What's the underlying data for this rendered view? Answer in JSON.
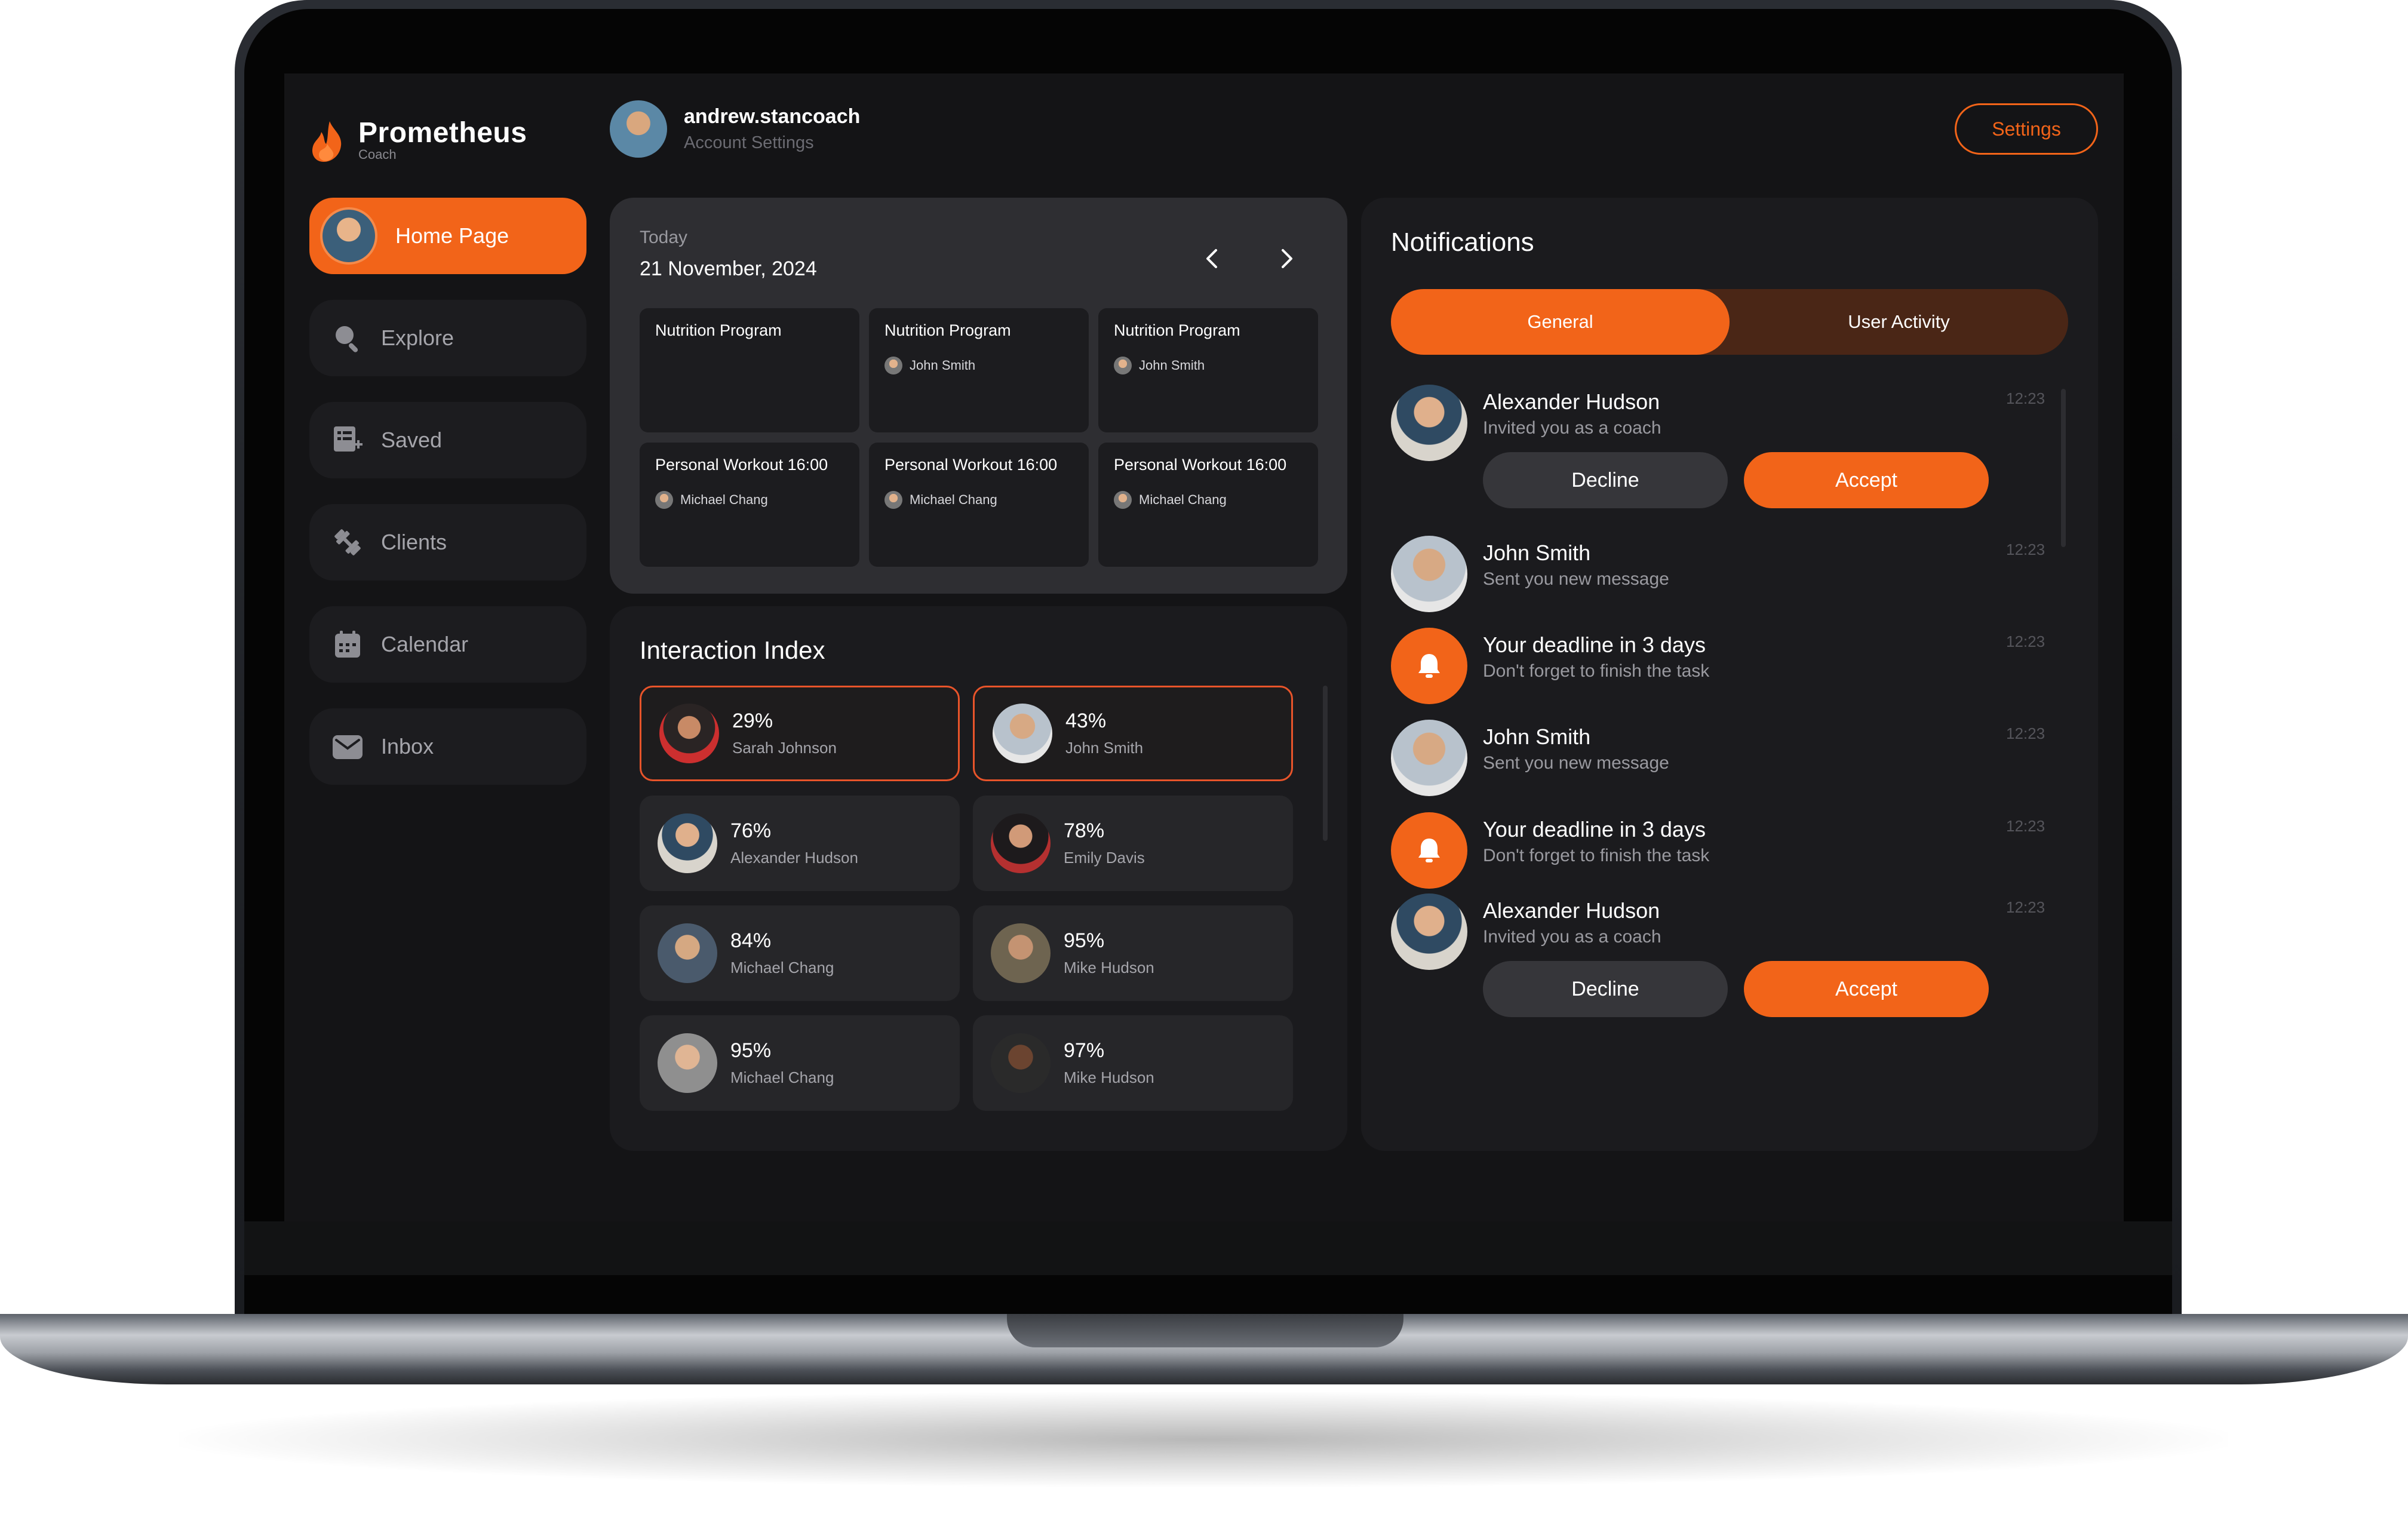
{
  "brand": {
    "name": "Prometheus",
    "sub": "Coach",
    "accent": "#f26419"
  },
  "user": {
    "name": "andrew.stancoach",
    "subtitle": "Account Settings"
  },
  "header": {
    "settings_label": "Settings"
  },
  "nav": {
    "items": [
      {
        "label": "Home Page",
        "icon": "avatar",
        "active": true
      },
      {
        "label": "Explore",
        "icon": "search-icon"
      },
      {
        "label": "Saved",
        "icon": "saved-list-icon"
      },
      {
        "label": "Clients",
        "icon": "dumbbell-icon"
      },
      {
        "label": "Calendar",
        "icon": "calendar-icon"
      },
      {
        "label": "Inbox",
        "icon": "mail-icon"
      }
    ]
  },
  "calendar": {
    "label": "Today",
    "date": "21 November, 2024",
    "cards": [
      {
        "title": "Nutrition Program",
        "person": ""
      },
      {
        "title": "Nutrition Program",
        "person": "John Smith"
      },
      {
        "title": "Nutrition Program",
        "person": "John Smith"
      },
      {
        "title": "Personal Workout 16:00",
        "person": "Michael Chang"
      },
      {
        "title": "Personal Workout 16:00",
        "person": "Michael Chang"
      },
      {
        "title": "Personal Workout 16:00",
        "person": "Michael Chang"
      }
    ]
  },
  "interaction": {
    "title": "Interaction Index",
    "cards": [
      {
        "pct": "29%",
        "name": "Sarah Johnson",
        "highlight": true
      },
      {
        "pct": "43%",
        "name": "John Smith",
        "highlight": true
      },
      {
        "pct": "76%",
        "name": "Alexander Hudson"
      },
      {
        "pct": "78%",
        "name": "Emily Davis"
      },
      {
        "pct": "84%",
        "name": "Michael Chang"
      },
      {
        "pct": "95%",
        "name": "Mike Hudson"
      },
      {
        "pct": "95%",
        "name": "Michael Chang"
      },
      {
        "pct": "97%",
        "name": "Mike Hudson"
      }
    ]
  },
  "notifications": {
    "title": "Notifications",
    "tabs": [
      {
        "label": "General",
        "active": true
      },
      {
        "label": "User Activity"
      }
    ],
    "items": [
      {
        "title": "Alexander Hudson",
        "sub": "Invited you as a coach",
        "time": "12:23",
        "decline": "Decline",
        "accept": "Accept"
      },
      {
        "title": "John Smith",
        "sub": "Sent you new message",
        "time": "12:23"
      },
      {
        "title": "Your deadline in 3 days",
        "sub": "Don't forget to finish the task",
        "time": "12:23"
      },
      {
        "title": "John Smith",
        "sub": "Sent you new message",
        "time": "12:23"
      },
      {
        "title": "Your deadline in 3 days",
        "sub": "Don't forget to finish the task",
        "time": "12:23"
      },
      {
        "title": "Alexander Hudson",
        "sub": "Invited you as a coach",
        "time": "12:23",
        "decline": "Decline",
        "accept": "Accept"
      }
    ]
  }
}
